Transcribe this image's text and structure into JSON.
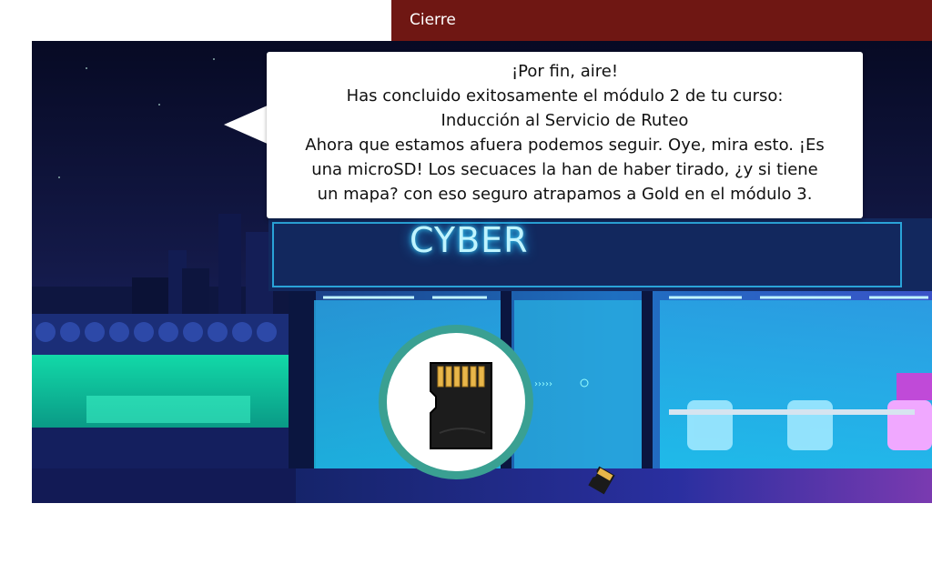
{
  "header": {
    "title": "Cierre"
  },
  "dialog": {
    "lines": [
      "¡Por fin, aire!",
      "Has concluido exitosamente el módulo 2 de tu curso:",
      "Inducción al Servicio de Ruteo",
      "Ahora que estamos afuera podemos seguir. Oye, mira esto. ¡Es",
      "una microSD! Los secuaces la han de haber tirado, ¿y si tiene",
      "un mapa? con eso seguro atrapamos a Gold en el módulo 3."
    ]
  },
  "scene": {
    "sign_text": "CYBER",
    "colors": {
      "header": "#6f1713",
      "sky": "#0a0d2e",
      "neon": "#3ad7ff",
      "ring": "#3aa092"
    }
  },
  "items": {
    "focus_item_icon": "microsd-card-icon",
    "dropped_item_icon": "microsd-card-icon"
  }
}
